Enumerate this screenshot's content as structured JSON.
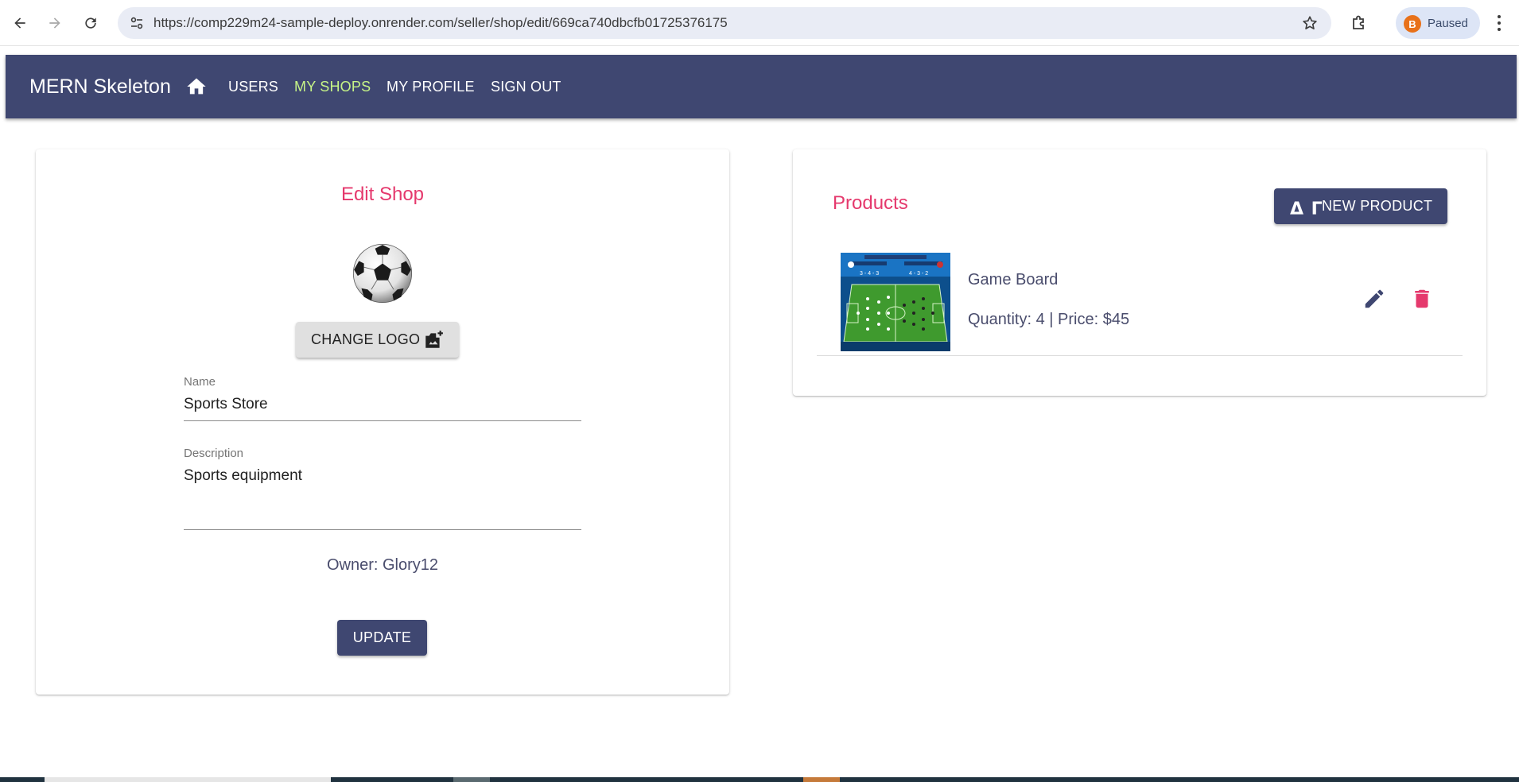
{
  "browser": {
    "url": "https://comp229m24-sample-deploy.onrender.com/seller/shop/edit/669ca740dbcfb01725376175",
    "profile_initial": "B",
    "profile_status": "Paused"
  },
  "app_bar": {
    "title": "MERN Skeleton",
    "nav": [
      "USERS",
      "MY SHOPS",
      "MY PROFILE",
      "SIGN OUT"
    ],
    "active_item": "MY SHOPS",
    "colors": {
      "background": "#3f4771",
      "active": "#c6f487"
    }
  },
  "edit_shop": {
    "title": "Edit Shop",
    "change_logo_label": "CHANGE LOGO",
    "name_label": "Name",
    "name_value": "Sports Store",
    "description_label": "Description",
    "description_value": "Sports equipment",
    "owner_text": "Owner: Glory12",
    "update_label": "UPDATE"
  },
  "products": {
    "title": "Products",
    "new_product_icon_text": "Δ Γ",
    "new_product_label": "NEW PRODUCT",
    "items": [
      {
        "name": "Game Board",
        "meta": "Quantity: 4 | Price: $45",
        "thumb_left_formation": "3 - 4 - 3",
        "thumb_right_formation": "4 - 3 - 2"
      }
    ]
  },
  "colors": {
    "accent": "#e5396d",
    "primary": "#3f4771",
    "text": "#4a4d6d"
  }
}
